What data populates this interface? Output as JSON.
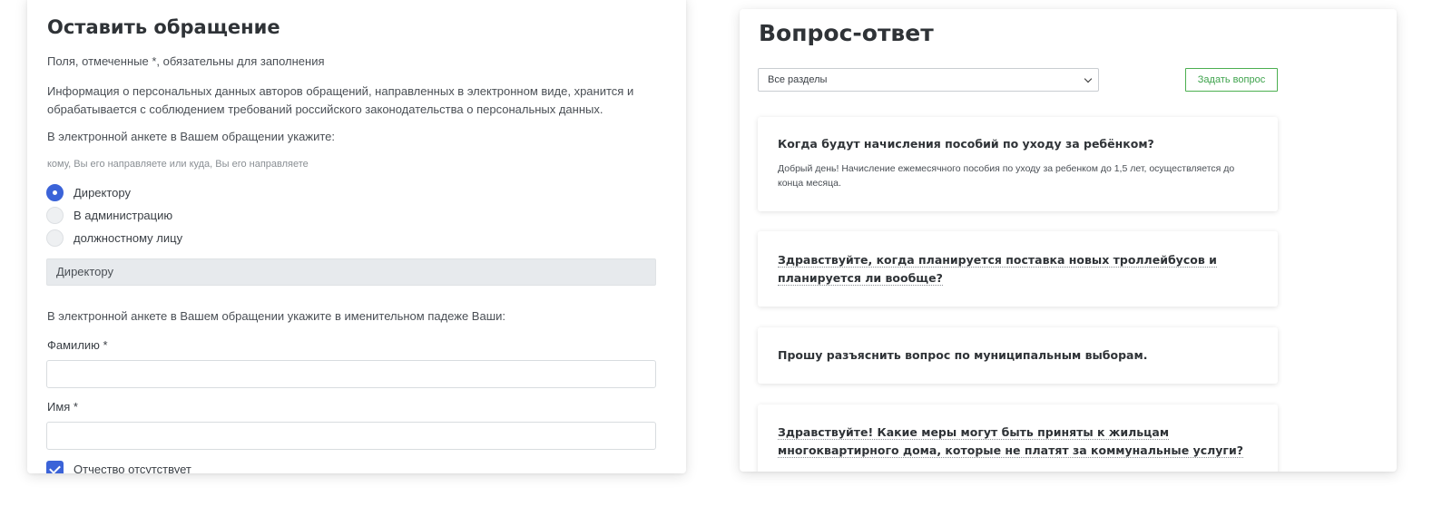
{
  "appeal_form": {
    "title": "Оставить обращение",
    "required_note": "Поля, отмеченные *, обязательны для заполнения",
    "privacy_note": "Информация о персональных данных авторов обращений, направленных в электронном виде, хранится и обрабатывается с соблюдением требований российского законодательства о персональных данных.",
    "recipient_intro": "В электронной анкете в Вашем обращении укажите:",
    "recipient_hint": "кому, Вы его направляете или куда, Вы его направляете",
    "recipient_options": [
      {
        "label": "Директору",
        "selected": true
      },
      {
        "label": "В администрацию",
        "selected": false
      },
      {
        "label": "должностному лицу",
        "selected": false
      }
    ],
    "recipient_value": "Директору",
    "name_intro": "В электронной анкете в Вашем обращении укажите в именительном падеже Ваши:",
    "surname_label": "Фамилию *",
    "surname_value": "",
    "firstname_label": "Имя *",
    "firstname_value": "",
    "no_patronymic_label": "Отчество отсутствует",
    "no_patronymic_checked": true
  },
  "faq": {
    "title": "Вопрос-ответ",
    "section_select_value": "Все разделы",
    "ask_button_label": "Задать вопрос",
    "items": [
      {
        "question": "Когда будут начисления пособий по уходу за ребёнком?",
        "answer": "Добрый день! Начисление ежемесячного пособия по уходу за ребенком до 1,5 лет, осуществляется до конца месяца."
      },
      {
        "question": "Здравствуйте, когда планируется поставка новых троллейбусов и планируется ли вообще?",
        "answer": ""
      },
      {
        "question": "Прошу разъяснить вопрос по муниципальным выборам.",
        "answer": ""
      },
      {
        "question": "Здравствуйте! Какие меры могут быть приняты к жильцам многоквартирного дома, которые не платят за коммунальные услуги?",
        "answer": ""
      }
    ]
  },
  "colors": {
    "accent_blue": "#3b63d8",
    "button_green": "#4caf50",
    "readonly_bg": "#e7eaed"
  }
}
